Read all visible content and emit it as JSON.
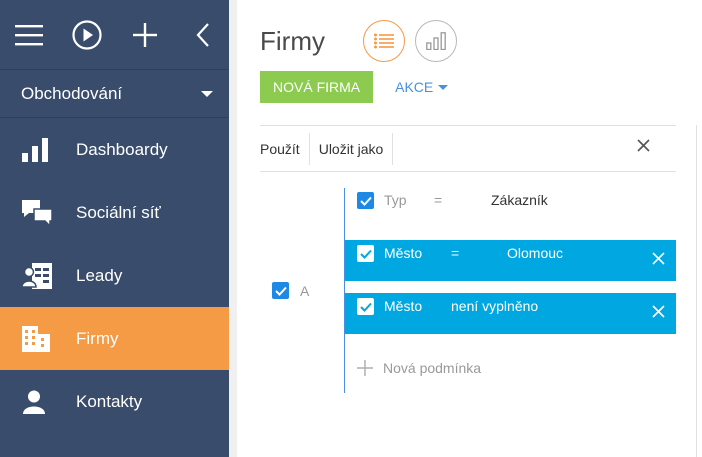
{
  "sidebar": {
    "section": "Obchodování",
    "items": [
      {
        "label": "Dashboardy",
        "icon": "bar-chart-icon"
      },
      {
        "label": "Sociální síť",
        "icon": "chat-bubbles-icon"
      },
      {
        "label": "Leady",
        "icon": "lead-card-icon"
      },
      {
        "label": "Firmy",
        "icon": "building-icon"
      },
      {
        "label": "Kontakty",
        "icon": "person-icon"
      }
    ]
  },
  "header": {
    "title": "Firmy"
  },
  "actions": {
    "new_label": "NOVÁ FIRMA",
    "akce_label": "AKCE"
  },
  "filter": {
    "apply_label": "Použít",
    "save_as_label": "Uložit jako",
    "group_label": "A",
    "conditions": [
      {
        "field": "Typ",
        "operator": "=",
        "value": "Zákazník"
      },
      {
        "field": "Město",
        "operator": "=",
        "value": "Olomouc"
      },
      {
        "field": "Město",
        "operator": "",
        "value": "není vyplněno"
      }
    ],
    "new_condition_label": "Nová podmínka"
  },
  "colors": {
    "sidebar_bg": "#394c6b",
    "active_item": "#f59a45",
    "new_button": "#8ccb4f",
    "selected_condition": "#00a7e1",
    "link": "#4a90e2"
  }
}
